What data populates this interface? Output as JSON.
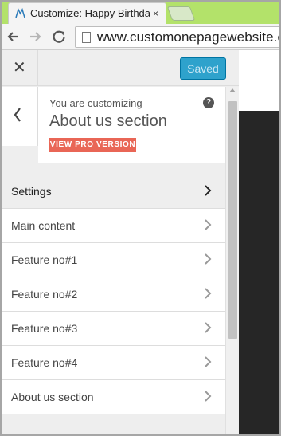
{
  "browser": {
    "tab_title": "Customize: Happy Birthda",
    "tab_close": "×",
    "tab_icon": "customizer-icon",
    "url": "www.customonepagewebsite.com",
    "back": "🡐",
    "forward": "🡒",
    "reload": "⟳"
  },
  "customizer": {
    "close": "✕",
    "saved_label": "Saved",
    "customizing_label": "You are customizing",
    "section_title": "About us section",
    "pro_button": "VIEW PRO VERSION",
    "help": "?",
    "back": "‹",
    "menu": [
      {
        "label": "Settings"
      },
      {
        "label": "Main content"
      },
      {
        "label": "Feature no#1"
      },
      {
        "label": "Feature no#2"
      },
      {
        "label": "Feature no#3"
      },
      {
        "label": "Feature no#4"
      },
      {
        "label": "About us section"
      }
    ]
  },
  "colors": {
    "tabstrip": "#b3e26a",
    "saved_button": "#2ea2cc",
    "pro_button": "#e96656",
    "preview_dark": "#262626"
  }
}
